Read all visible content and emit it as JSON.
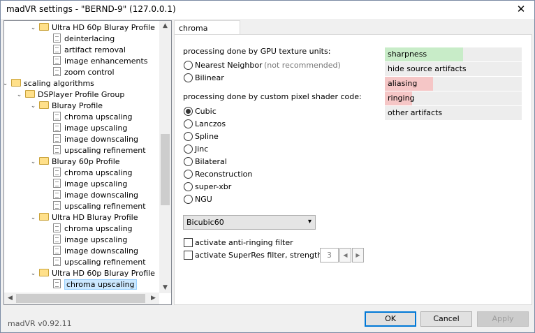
{
  "window": {
    "title": "madVR settings - \"BERND-9\" (127.0.0.1)"
  },
  "tree": {
    "items": [
      {
        "label": "Ultra HD 60p Bluray Profile",
        "kind": "folder"
      },
      {
        "label": "deinterlacing",
        "kind": "page"
      },
      {
        "label": "artifact removal",
        "kind": "page"
      },
      {
        "label": "image enhancements",
        "kind": "page"
      },
      {
        "label": "zoom control",
        "kind": "page"
      },
      {
        "label": "scaling algorithms",
        "kind": "folder"
      },
      {
        "label": "DSPlayer Profile Group",
        "kind": "folder"
      },
      {
        "label": "Bluray Profile",
        "kind": "folder"
      },
      {
        "label": "chroma upscaling",
        "kind": "page"
      },
      {
        "label": "image upscaling",
        "kind": "page"
      },
      {
        "label": "image downscaling",
        "kind": "page"
      },
      {
        "label": "upscaling refinement",
        "kind": "page"
      },
      {
        "label": "Bluray 60p Profile",
        "kind": "folder"
      },
      {
        "label": "chroma upscaling",
        "kind": "page"
      },
      {
        "label": "image upscaling",
        "kind": "page"
      },
      {
        "label": "image downscaling",
        "kind": "page"
      },
      {
        "label": "upscaling refinement",
        "kind": "page"
      },
      {
        "label": "Ultra HD Bluray Profile",
        "kind": "folder"
      },
      {
        "label": "chroma upscaling",
        "kind": "page"
      },
      {
        "label": "image upscaling",
        "kind": "page"
      },
      {
        "label": "image downscaling",
        "kind": "page"
      },
      {
        "label": "upscaling refinement",
        "kind": "page"
      },
      {
        "label": "Ultra HD 60p Bluray Profile",
        "kind": "folder"
      },
      {
        "label": "chroma upscaling",
        "kind": "page",
        "selected": true
      }
    ]
  },
  "tab": {
    "label": "chroma upscaling"
  },
  "gpu_section": {
    "heading": "processing done by GPU texture units:",
    "options": [
      "Nearest Neighbor",
      "Bilinear"
    ],
    "note": "(not recommended)"
  },
  "shader_section": {
    "heading": "processing done by custom pixel shader code:",
    "options": [
      "Cubic",
      "Lanczos",
      "Spline",
      "Jinc",
      "Bilateral",
      "Reconstruction",
      "super-xbr",
      "NGU"
    ],
    "selected": "Cubic"
  },
  "filter_select": {
    "value": "Bicubic60"
  },
  "checkboxes": {
    "anti_ringing": "activate anti-ringing filter",
    "superres": "activate SuperRes filter, strength:",
    "strength": "3"
  },
  "legend": [
    {
      "label": "sharpness",
      "color": "#c8ecc8",
      "level": 0.57
    },
    {
      "label": "hide source artifacts",
      "color": "#ededed",
      "level": 0
    },
    {
      "label": "aliasing",
      "color": "#f5c6c6",
      "level": 0.35
    },
    {
      "label": "ringing",
      "color": "#f5c6c6",
      "level": 0.2
    },
    {
      "label": "other artifacts",
      "color": "#ededed",
      "level": 0
    }
  ],
  "footer": {
    "version": "madVR v0.92.11",
    "ok": "OK",
    "cancel": "Cancel",
    "apply": "Apply"
  }
}
